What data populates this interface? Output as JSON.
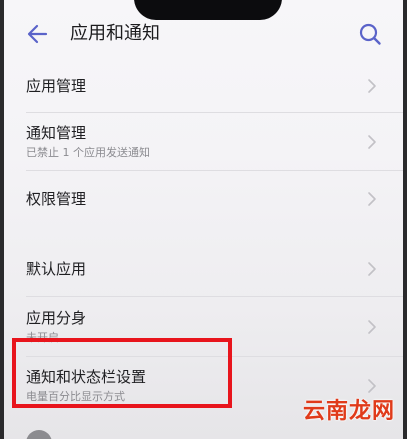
{
  "header": {
    "back_icon": "arrow-left-icon",
    "title": "应用和通知",
    "search_icon": "search-icon",
    "accent_color": "#5a63c9"
  },
  "list": {
    "items": [
      {
        "label": "应用管理",
        "subtitle": ""
      },
      {
        "label": "通知管理",
        "subtitle": "已禁止 1 个应用发送通知"
      },
      {
        "label": "权限管理",
        "subtitle": ""
      },
      {
        "label": "默认应用",
        "subtitle": ""
      },
      {
        "label": "应用分身",
        "subtitle": "未开启"
      },
      {
        "label": "通知和状态栏设置",
        "subtitle": "电量百分比显示方式"
      }
    ],
    "chevron_icon": "chevron-right-icon"
  },
  "overlay": {
    "highlight_color": "#e8141c",
    "watermark": "云南龙网",
    "watermark_color": "#e03a1a"
  }
}
